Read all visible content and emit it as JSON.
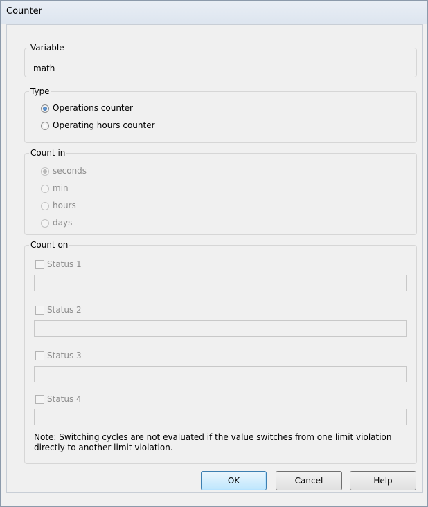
{
  "window": {
    "title": "Counter"
  },
  "variable": {
    "legend": "Variable",
    "value": "math"
  },
  "type": {
    "legend": "Type",
    "options": [
      {
        "label": "Operations counter",
        "checked": true
      },
      {
        "label": "Operating hours counter",
        "checked": false
      }
    ]
  },
  "count_in": {
    "legend": "Count in",
    "options": [
      {
        "label": "seconds",
        "checked": true
      },
      {
        "label": "min",
        "checked": false
      },
      {
        "label": "hours",
        "checked": false
      },
      {
        "label": "days",
        "checked": false
      }
    ]
  },
  "count_on": {
    "legend": "Count on",
    "statuses": [
      {
        "label": "Status 1",
        "value": ""
      },
      {
        "label": "Status 2",
        "value": ""
      },
      {
        "label": "Status 3",
        "value": ""
      },
      {
        "label": "Status 4",
        "value": ""
      }
    ],
    "note": "Note: Switching cycles are not evaluated if the value switches from one limit violation directly to another limit violation."
  },
  "buttons": {
    "ok": "OK",
    "cancel": "Cancel",
    "help": "Help"
  }
}
